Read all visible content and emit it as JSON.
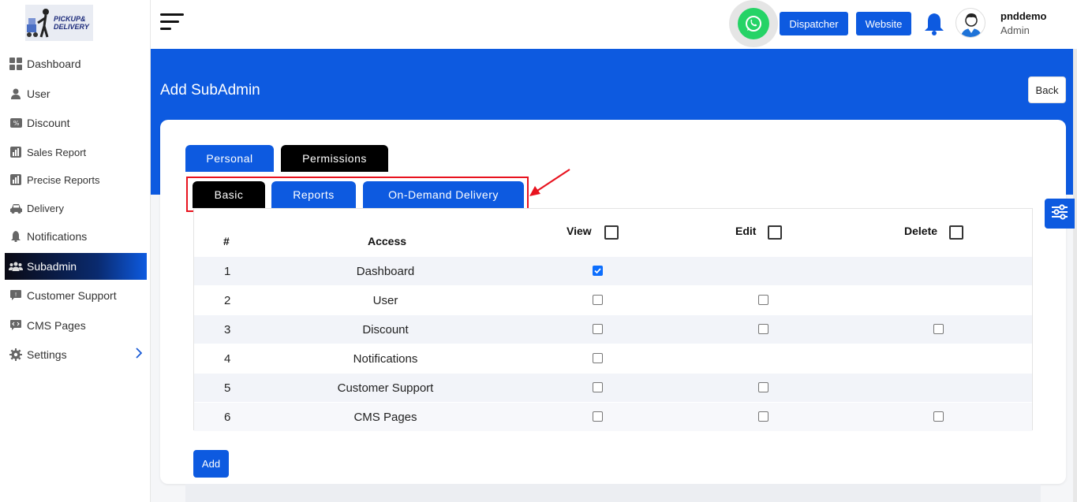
{
  "logo": {
    "line1": "PICKUP&",
    "line2": "DELIVERY"
  },
  "sidebar": {
    "items": [
      {
        "label": "Dashboard",
        "icon": "grid-icon"
      },
      {
        "label": "User",
        "icon": "user-icon"
      },
      {
        "label": "Discount",
        "icon": "discount-icon"
      },
      {
        "label": "Sales Report",
        "icon": "report-icon"
      },
      {
        "label": "Precise Reports",
        "icon": "report-icon"
      },
      {
        "label": "Delivery",
        "icon": "car-icon"
      },
      {
        "label": "Notifications",
        "icon": "bell-icon"
      },
      {
        "label": "Subadmin",
        "icon": "users-icon",
        "active": true
      },
      {
        "label": "Customer Support",
        "icon": "chat-icon"
      },
      {
        "label": "CMS Pages",
        "icon": "code-chat-icon"
      },
      {
        "label": "Settings",
        "icon": "gear-icon"
      }
    ]
  },
  "topbar": {
    "dispatcher_label": "Dispatcher",
    "website_label": "Website",
    "user_name": "pnddemo",
    "user_role": "Admin"
  },
  "page": {
    "title": "Add SubAdmin",
    "back_label": "Back",
    "add_label": "Add"
  },
  "tabs": {
    "personal": "Personal",
    "permissions": "Permissions"
  },
  "subtabs": {
    "basic": "Basic",
    "reports": "Reports",
    "on_demand": "On-Demand Delivery"
  },
  "table": {
    "headers": {
      "num": "#",
      "access": "Access",
      "view": "View",
      "edit": "Edit",
      "delete": "Delete"
    },
    "rows": [
      {
        "num": "1",
        "access": "Dashboard",
        "view": true,
        "edit": null,
        "delete": null
      },
      {
        "num": "2",
        "access": "User",
        "view": false,
        "edit": false,
        "delete": null
      },
      {
        "num": "3",
        "access": "Discount",
        "view": false,
        "edit": false,
        "delete": false
      },
      {
        "num": "4",
        "access": "Notifications",
        "view": false,
        "edit": null,
        "delete": null
      },
      {
        "num": "5",
        "access": "Customer Support",
        "view": false,
        "edit": false,
        "delete": null
      },
      {
        "num": "6",
        "access": "CMS Pages",
        "view": false,
        "edit": false,
        "delete": false
      }
    ]
  },
  "colors": {
    "primary": "#0d5ae0",
    "highlight": "#e8131f",
    "whatsapp": "#25d366"
  }
}
